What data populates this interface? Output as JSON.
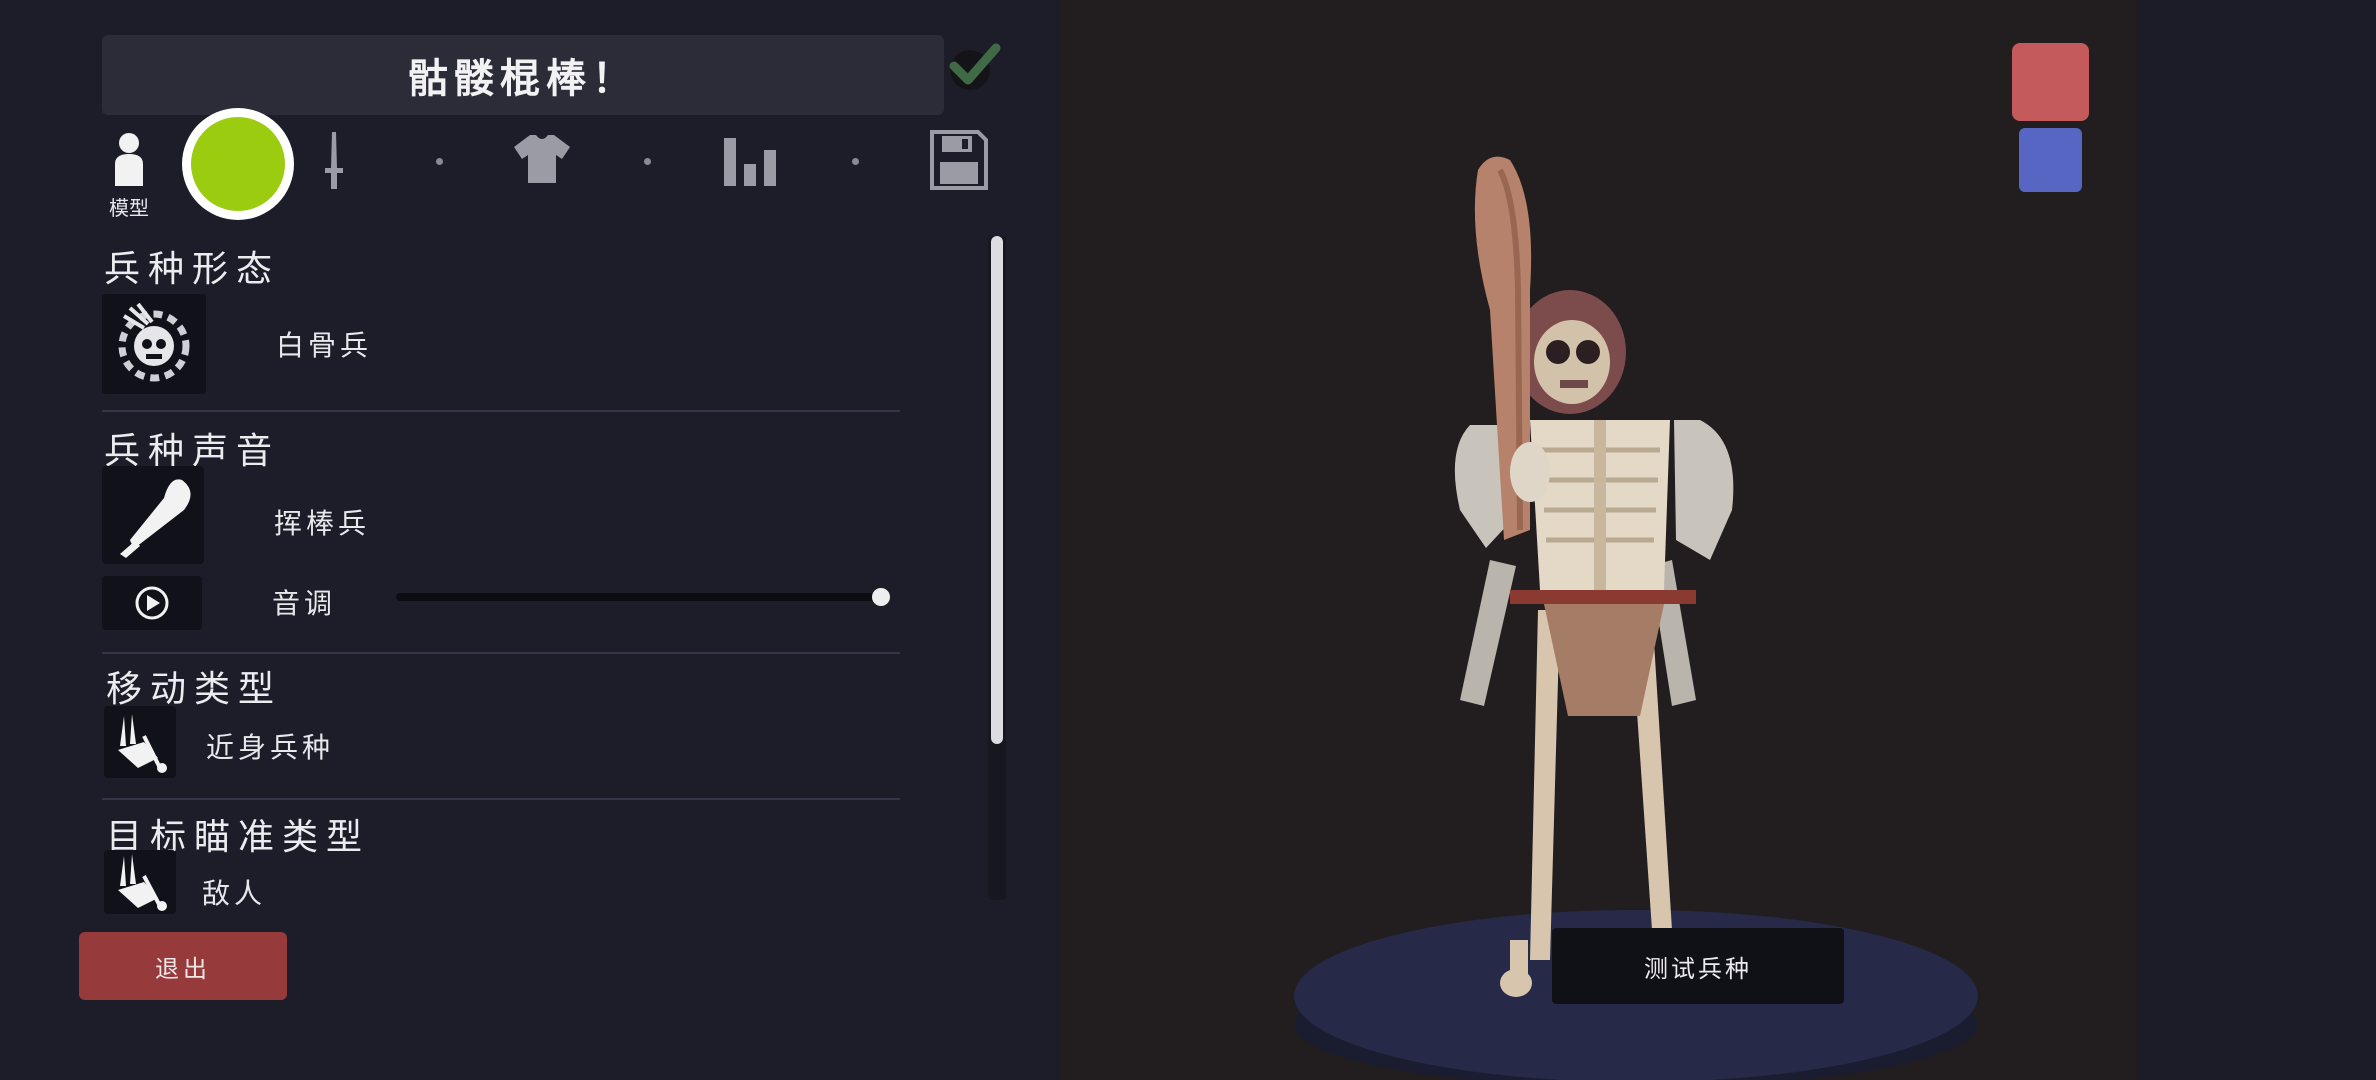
{
  "header": {
    "title": "骷髅棍棒！"
  },
  "toolbar": {
    "model_label": "模型",
    "color_swatch": "#9ccc10",
    "icons": [
      "person-icon",
      "sword-icon",
      "shirt-icon",
      "bar-chart-icon",
      "save-icon"
    ]
  },
  "sections": {
    "unit_form": {
      "title": "兵种形态",
      "value": "白骨兵"
    },
    "unit_voice": {
      "title": "兵种声音",
      "value": "挥棒兵",
      "pitch_label": "音调",
      "pitch_level": 1.0
    },
    "movement_type": {
      "title": "移动类型",
      "value": "近身兵种"
    },
    "targeting_type": {
      "title": "目标瞄准类型",
      "value": "敌人"
    }
  },
  "buttons": {
    "exit": "退出",
    "test_unit": "测试兵种"
  },
  "teams": {
    "red": "#c45a5c",
    "blue": "#5766c2"
  }
}
